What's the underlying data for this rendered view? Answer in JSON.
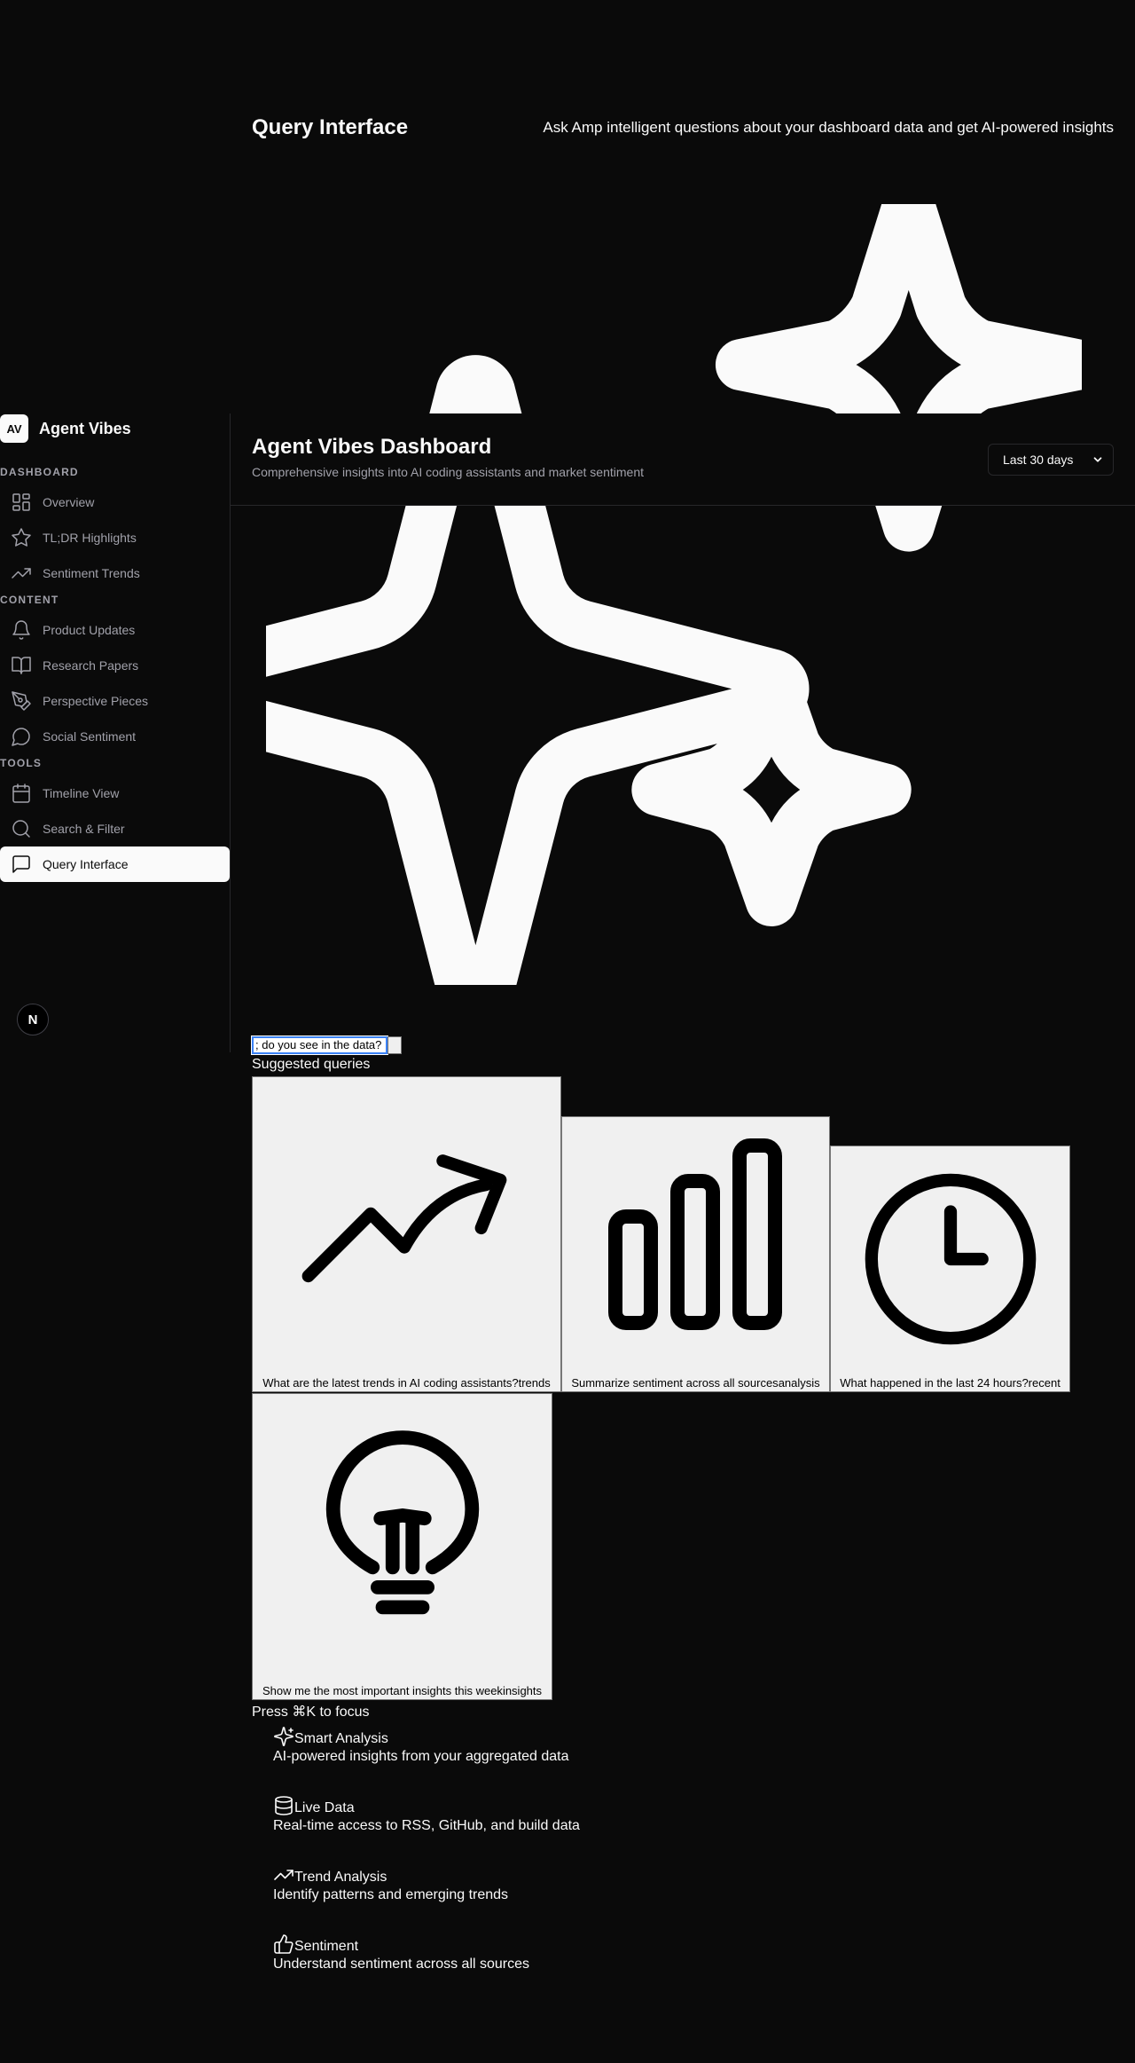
{
  "page": {
    "title": "Query Interface",
    "subtitle": "Ask Amp intelligent questions about your dashboard data and get AI-powered insights"
  },
  "sidebar": {
    "brand_initials": "AV",
    "brand_name": "Agent Vibes",
    "groups": [
      {
        "label": "DASHBOARD",
        "items": [
          {
            "label": "Overview",
            "icon": "layout-dashboard-icon"
          },
          {
            "label": "TL;DR Highlights",
            "icon": "star-icon"
          },
          {
            "label": "Sentiment Trends",
            "icon": "trending-up-icon"
          }
        ]
      },
      {
        "label": "CONTENT",
        "items": [
          {
            "label": "Product Updates",
            "icon": "bell-icon"
          },
          {
            "label": "Research Papers",
            "icon": "book-open-icon"
          },
          {
            "label": "Perspective Pieces",
            "icon": "pen-tool-icon"
          },
          {
            "label": "Social Sentiment",
            "icon": "message-circle-icon"
          }
        ]
      },
      {
        "label": "TOOLS",
        "items": [
          {
            "label": "Timeline View",
            "icon": "calendar-icon"
          },
          {
            "label": "Search & Filter",
            "icon": "search-icon"
          },
          {
            "label": "Query Interface",
            "icon": "message-square-icon",
            "active": true
          }
        ]
      }
    ],
    "next_badge": "N"
  },
  "topbar": {
    "title": "Agent Vibes Dashboard",
    "subtitle": "Comprehensive insights into AI coding assistants and market sentiment",
    "range_selected": "Last 30 days"
  },
  "query": {
    "value": "; do you see in the data?",
    "suggested_label": "Suggested queries",
    "suggestions": [
      {
        "text": "What are the latest trends in AI coding assistants?",
        "tag": "trends",
        "icon": "trending-up-icon"
      },
      {
        "text": "Summarize sentiment across all sources",
        "tag": "analysis",
        "icon": "bar-chart-icon"
      },
      {
        "text": "What happened in the last 24 hours?",
        "tag": "recent",
        "icon": "clock-icon"
      },
      {
        "text": "Show me the most important insights this week",
        "tag": "insights",
        "icon": "lightbulb-icon"
      }
    ],
    "focus_hint": "Press ⌘K to focus"
  },
  "features": [
    {
      "title": "Smart Analysis",
      "desc": "AI-powered insights from your aggregated data",
      "icon": "sparkles-icon"
    },
    {
      "title": "Live Data",
      "desc": "Real-time access to RSS, GitHub, and build data",
      "icon": "database-icon"
    },
    {
      "title": "Trend Analysis",
      "desc": "Identify patterns and emerging trends",
      "icon": "trending-up-icon"
    },
    {
      "title": "Sentiment",
      "desc": "Understand sentiment across all sources",
      "icon": "thumbs-up-icon"
    }
  ],
  "colors": {
    "background": "#0a0a0a",
    "foreground": "#fafafa",
    "muted": "#a1a1aa",
    "border": "#27272a",
    "card": "#f0f0f0"
  }
}
